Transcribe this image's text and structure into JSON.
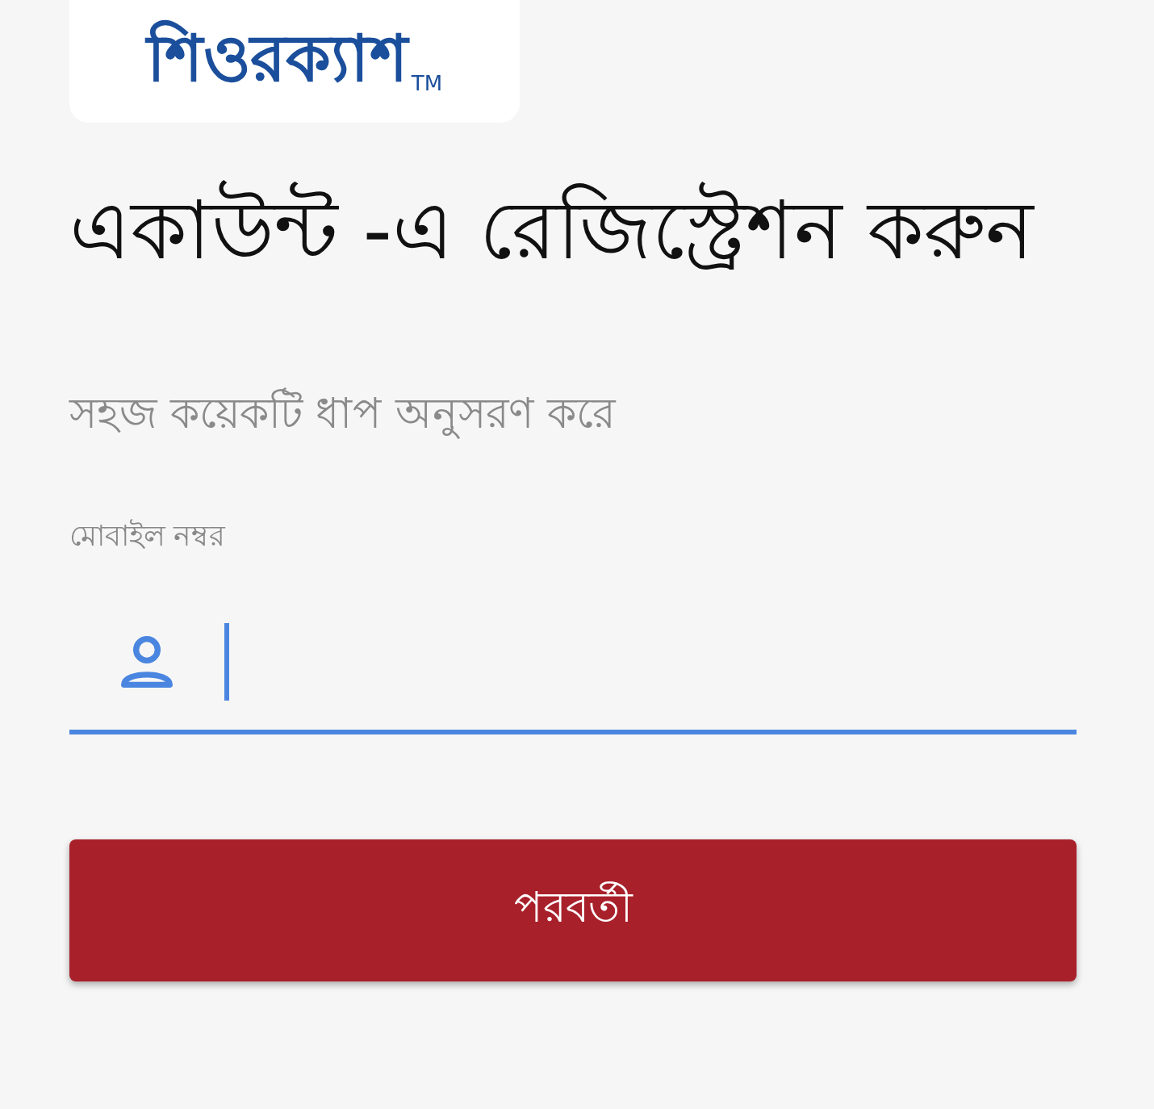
{
  "logo": {
    "name": "শিওরক্যাশ",
    "mark": "TM"
  },
  "title": "একাউন্ট -এ রেজিস্ট্রেশন করুন",
  "subtitle": "সহজ কয়েকটি ধাপ অনুসরণ করে",
  "field": {
    "label": "মোবাইল নম্বর",
    "focused": true
  },
  "button": "পরবর্তী"
}
